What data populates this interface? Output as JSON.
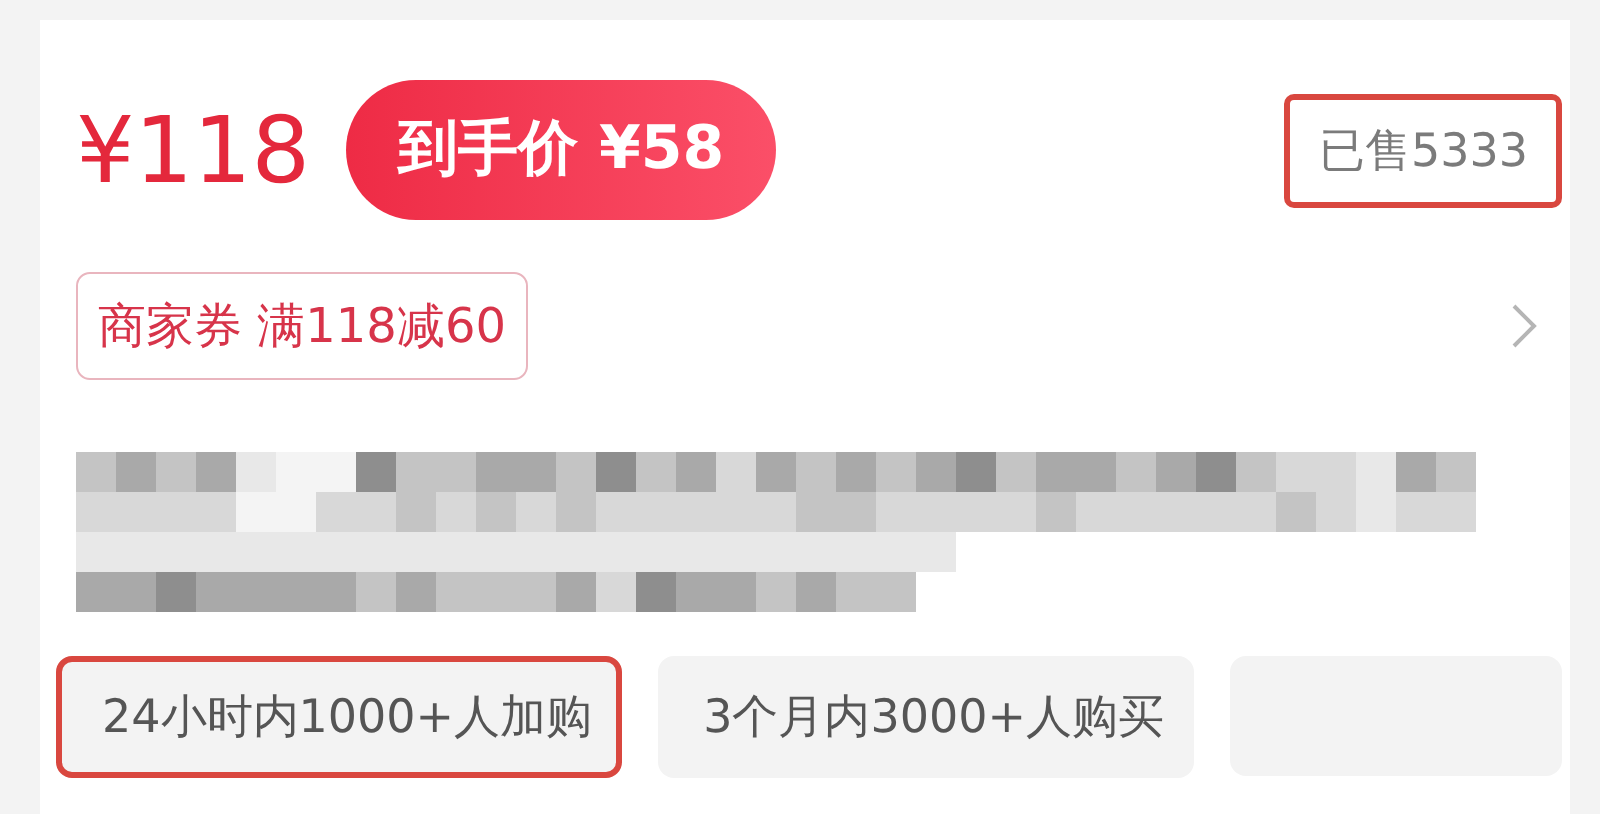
{
  "price": {
    "original": "¥118",
    "final_label": "到手价 ¥58"
  },
  "sold": {
    "text": "已售5333",
    "highlighted": true
  },
  "coupon": {
    "text": "商家券 满118减60"
  },
  "tags": [
    {
      "text": "24小时内1000+人加购",
      "highlighted": true
    },
    {
      "text": "3个月内3000+人购买",
      "highlighted": false
    },
    {
      "highlighted": false
    }
  ]
}
